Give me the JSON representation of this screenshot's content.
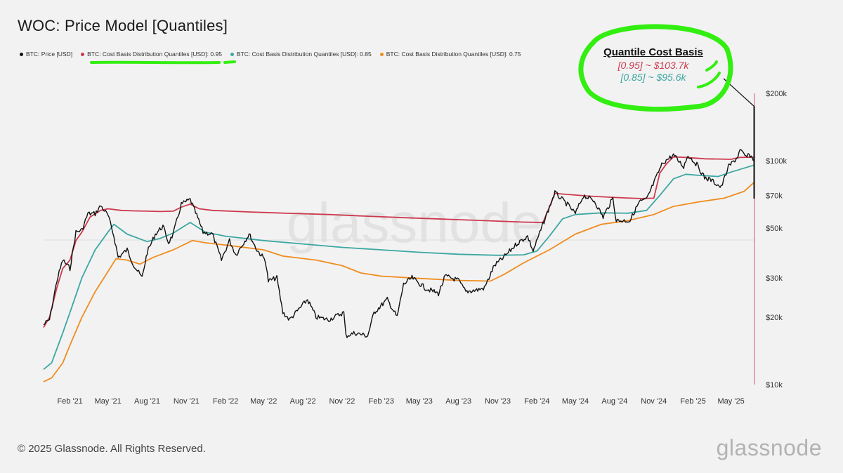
{
  "chart_data": {
    "type": "line",
    "title": "WOC: Price Model [Quantiles]",
    "y_scale": "log",
    "ylim": [
      10000,
      200000
    ],
    "x_range": [
      "2020-12-01",
      "2025-06-25"
    ],
    "x_ticks": [
      "Feb '21",
      "May '21",
      "Aug '21",
      "Nov '21",
      "Feb '22",
      "May '22",
      "Aug '22",
      "Nov '22",
      "Feb '23",
      "May '23",
      "Aug '23",
      "Nov '23",
      "Feb '24",
      "May '24",
      "Aug '24",
      "Nov '24",
      "Feb '25",
      "May '25"
    ],
    "x_tick_dates": [
      "2021-02-01",
      "2021-05-01",
      "2021-08-01",
      "2021-11-01",
      "2022-02-01",
      "2022-05-01",
      "2022-08-01",
      "2022-11-01",
      "2023-02-01",
      "2023-05-01",
      "2023-08-01",
      "2023-11-01",
      "2024-02-01",
      "2024-05-01",
      "2024-08-01",
      "2024-11-01",
      "2025-02-01",
      "2025-05-01"
    ],
    "y_ticks": [
      {
        "value": 10000,
        "label": "$10k"
      },
      {
        "value": 20000,
        "label": "$20k"
      },
      {
        "value": 30000,
        "label": "$30k"
      },
      {
        "value": 50000,
        "label": "$50k"
      },
      {
        "value": 70000,
        "label": "$70k"
      },
      {
        "value": 100000,
        "label": "$100k"
      },
      {
        "value": 200000,
        "label": "$200k"
      }
    ],
    "series": [
      {
        "name": "BTC: Price [USD]",
        "color": "#111111",
        "points": [
          [
            "2020-12-01",
            18500
          ],
          [
            "2020-12-15",
            19500
          ],
          [
            "2021-01-01",
            29000
          ],
          [
            "2021-01-15",
            36000
          ],
          [
            "2021-02-01",
            33000
          ],
          [
            "2021-02-15",
            48000
          ],
          [
            "2021-03-01",
            49000
          ],
          [
            "2021-03-15",
            58000
          ],
          [
            "2021-04-01",
            58000
          ],
          [
            "2021-04-14",
            63000
          ],
          [
            "2021-05-01",
            57000
          ],
          [
            "2021-05-15",
            46000
          ],
          [
            "2021-05-25",
            37000
          ],
          [
            "2021-06-15",
            40000
          ],
          [
            "2021-07-01",
            34000
          ],
          [
            "2021-07-20",
            30000
          ],
          [
            "2021-08-01",
            39000
          ],
          [
            "2021-08-20",
            47000
          ],
          [
            "2021-09-07",
            51000
          ],
          [
            "2021-09-20",
            43000
          ],
          [
            "2021-10-01",
            47000
          ],
          [
            "2021-10-20",
            64000
          ],
          [
            "2021-11-10",
            67000
          ],
          [
            "2021-11-25",
            57000
          ],
          [
            "2021-12-10",
            48000
          ],
          [
            "2022-01-01",
            47000
          ],
          [
            "2022-01-22",
            36000
          ],
          [
            "2022-02-10",
            44000
          ],
          [
            "2022-02-25",
            38000
          ],
          [
            "2022-03-28",
            47000
          ],
          [
            "2022-04-15",
            40000
          ],
          [
            "2022-05-05",
            36000
          ],
          [
            "2022-05-12",
            29000
          ],
          [
            "2022-06-01",
            30000
          ],
          [
            "2022-06-15",
            21000
          ],
          [
            "2022-07-01",
            19500
          ],
          [
            "2022-08-12",
            24000
          ],
          [
            "2022-09-01",
            20000
          ],
          [
            "2022-10-01",
            19500
          ],
          [
            "2022-11-05",
            21000
          ],
          [
            "2022-11-10",
            16500
          ],
          [
            "2022-12-01",
            17000
          ],
          [
            "2022-12-31",
            16500
          ],
          [
            "2023-01-15",
            21000
          ],
          [
            "2023-02-15",
            24000
          ],
          [
            "2023-03-10",
            20000
          ],
          [
            "2023-03-25",
            28000
          ],
          [
            "2023-04-14",
            30000
          ],
          [
            "2023-05-15",
            27000
          ],
          [
            "2023-06-15",
            25500
          ],
          [
            "2023-07-01",
            30500
          ],
          [
            "2023-08-01",
            29200
          ],
          [
            "2023-08-18",
            26000
          ],
          [
            "2023-09-15",
            26500
          ],
          [
            "2023-10-01",
            27000
          ],
          [
            "2023-10-24",
            34000
          ],
          [
            "2023-11-15",
            37000
          ],
          [
            "2023-12-15",
            42500
          ],
          [
            "2024-01-10",
            46000
          ],
          [
            "2024-01-23",
            39500
          ],
          [
            "2024-02-15",
            52000
          ],
          [
            "2024-03-14",
            72000
          ],
          [
            "2024-04-15",
            63000
          ],
          [
            "2024-05-01",
            58000
          ],
          [
            "2024-05-20",
            70000
          ],
          [
            "2024-06-15",
            66000
          ],
          [
            "2024-07-05",
            56000
          ],
          [
            "2024-07-28",
            68000
          ],
          [
            "2024-08-05",
            54000
          ],
          [
            "2024-09-06",
            54000
          ],
          [
            "2024-09-28",
            65500
          ],
          [
            "2024-10-15",
            67000
          ],
          [
            "2024-11-12",
            89000
          ],
          [
            "2024-11-22",
            98000
          ],
          [
            "2024-12-17",
            106000
          ],
          [
            "2025-01-10",
            94000
          ],
          [
            "2025-01-20",
            106000
          ],
          [
            "2025-02-10",
            96000
          ],
          [
            "2025-02-28",
            84000
          ],
          [
            "2025-03-15",
            82000
          ],
          [
            "2025-04-08",
            76000
          ],
          [
            "2025-04-25",
            94000
          ],
          [
            "2025-05-15",
            103000
          ],
          [
            "2025-05-22",
            111000
          ],
          [
            "2025-06-05",
            104000
          ],
          [
            "2025-06-15",
            106000
          ],
          [
            "2025-06-22",
            101000
          ],
          [
            "2025-06-24",
            105000
          ]
        ]
      },
      {
        "name": "BTC: Cost Basis Distribution Quantiles [USD]: 0.95",
        "color": "#cc3a4e",
        "points": [
          [
            "2020-12-01",
            18000
          ],
          [
            "2020-12-15",
            20000
          ],
          [
            "2021-01-01",
            27000
          ],
          [
            "2021-01-15",
            33000
          ],
          [
            "2021-02-01",
            36000
          ],
          [
            "2021-02-15",
            44000
          ],
          [
            "2021-03-01",
            48000
          ],
          [
            "2021-03-20",
            56000
          ],
          [
            "2021-04-14",
            60000
          ],
          [
            "2021-05-01",
            61000
          ],
          [
            "2021-06-01",
            60000
          ],
          [
            "2021-07-01",
            59700
          ],
          [
            "2021-08-01",
            59500
          ],
          [
            "2021-09-01",
            59300
          ],
          [
            "2021-10-01",
            59500
          ],
          [
            "2021-10-20",
            62000
          ],
          [
            "2021-11-10",
            64000
          ],
          [
            "2021-12-01",
            61000
          ],
          [
            "2022-01-01",
            60000
          ],
          [
            "2022-04-01",
            59000
          ],
          [
            "2022-07-01",
            58200
          ],
          [
            "2022-10-01",
            57500
          ],
          [
            "2023-01-01",
            56500
          ],
          [
            "2023-04-01",
            55600
          ],
          [
            "2023-07-01",
            54800
          ],
          [
            "2023-10-01",
            54000
          ],
          [
            "2024-01-01",
            53200
          ],
          [
            "2024-02-15",
            53000
          ],
          [
            "2024-03-01",
            62000
          ],
          [
            "2024-03-14",
            71500
          ],
          [
            "2024-04-01",
            71000
          ],
          [
            "2024-06-01",
            69500
          ],
          [
            "2024-08-01",
            68500
          ],
          [
            "2024-10-01",
            67800
          ],
          [
            "2024-11-01",
            68000
          ],
          [
            "2024-11-15",
            88000
          ],
          [
            "2024-12-01",
            97000
          ],
          [
            "2024-12-17",
            104000
          ],
          [
            "2025-01-15",
            103500
          ],
          [
            "2025-03-01",
            102000
          ],
          [
            "2025-05-01",
            101500
          ],
          [
            "2025-05-22",
            103500
          ],
          [
            "2025-06-24",
            103700
          ]
        ]
      },
      {
        "name": "BTC: Cost Basis Distribution Quantiles [USD]: 0.85",
        "color": "#3ca7a2",
        "points": [
          [
            "2020-12-01",
            11700
          ],
          [
            "2020-12-20",
            12500
          ],
          [
            "2021-01-15",
            17000
          ],
          [
            "2021-02-01",
            21000
          ],
          [
            "2021-03-01",
            30000
          ],
          [
            "2021-04-01",
            40000
          ],
          [
            "2021-05-01",
            48000
          ],
          [
            "2021-05-15",
            52000
          ],
          [
            "2021-06-15",
            47000
          ],
          [
            "2021-08-01",
            43500
          ],
          [
            "2021-09-01",
            45000
          ],
          [
            "2021-10-01",
            47500
          ],
          [
            "2021-11-10",
            53000
          ],
          [
            "2021-12-15",
            48000
          ],
          [
            "2022-02-01",
            46000
          ],
          [
            "2022-05-01",
            44000
          ],
          [
            "2022-08-01",
            42500
          ],
          [
            "2022-11-01",
            41000
          ],
          [
            "2023-02-01",
            40000
          ],
          [
            "2023-05-01",
            39000
          ],
          [
            "2023-08-01",
            38200
          ],
          [
            "2023-11-01",
            37800
          ],
          [
            "2024-01-01",
            38000
          ],
          [
            "2024-02-01",
            39500
          ],
          [
            "2024-03-01",
            46000
          ],
          [
            "2024-04-01",
            55000
          ],
          [
            "2024-05-01",
            57500
          ],
          [
            "2024-07-01",
            58500
          ],
          [
            "2024-09-01",
            58300
          ],
          [
            "2024-10-15",
            60000
          ],
          [
            "2024-11-15",
            70000
          ],
          [
            "2024-12-17",
            83000
          ],
          [
            "2025-01-15",
            87000
          ],
          [
            "2025-02-15",
            86000
          ],
          [
            "2025-04-01",
            85000
          ],
          [
            "2025-05-01",
            89000
          ],
          [
            "2025-06-24",
            95600
          ]
        ]
      },
      {
        "name": "BTC: Cost Basis Distribution Quantiles [USD]: 0.75",
        "color": "#f08c1e",
        "points": [
          [
            "2020-12-01",
            10300
          ],
          [
            "2020-12-20",
            10700
          ],
          [
            "2021-01-15",
            12500
          ],
          [
            "2021-02-01",
            15000
          ],
          [
            "2021-03-01",
            20000
          ],
          [
            "2021-04-01",
            26000
          ],
          [
            "2021-05-01",
            32000
          ],
          [
            "2021-05-20",
            36500
          ],
          [
            "2021-06-15",
            36000
          ],
          [
            "2021-07-15",
            34500
          ],
          [
            "2021-08-15",
            37000
          ],
          [
            "2021-10-01",
            40000
          ],
          [
            "2021-11-15",
            44000
          ],
          [
            "2021-12-15",
            43000
          ],
          [
            "2022-02-01",
            42000
          ],
          [
            "2022-05-01",
            40000
          ],
          [
            "2022-06-15",
            37500
          ],
          [
            "2022-09-01",
            36000
          ],
          [
            "2022-11-01",
            34000
          ],
          [
            "2022-12-15",
            31500
          ],
          [
            "2023-02-01",
            30500
          ],
          [
            "2023-05-01",
            29800
          ],
          [
            "2023-08-01",
            29200
          ],
          [
            "2023-10-15",
            29000
          ],
          [
            "2023-11-15",
            31000
          ],
          [
            "2024-01-01",
            35000
          ],
          [
            "2024-03-01",
            40000
          ],
          [
            "2024-05-01",
            47000
          ],
          [
            "2024-07-01",
            52000
          ],
          [
            "2024-09-01",
            54000
          ],
          [
            "2024-11-01",
            57500
          ],
          [
            "2024-12-17",
            62500
          ],
          [
            "2025-02-15",
            65500
          ],
          [
            "2025-04-15",
            68000
          ],
          [
            "2025-06-01",
            73000
          ],
          [
            "2025-06-24",
            80000
          ]
        ]
      }
    ],
    "annotation": {
      "title": "Quantile Cost Basis",
      "q95": "[0.95] ~ $103.7k",
      "q85": "[0.85] ~ $95.6k"
    },
    "legend_position": "top-left",
    "grid": false
  },
  "legend": [
    {
      "label": "BTC: Price [USD]",
      "color": "#111111"
    },
    {
      "label": "BTC: Cost Basis Distribution Quantiles [USD]: 0.95",
      "color": "#cc3a4e"
    },
    {
      "label": "BTC: Cost Basis Distribution Quantiles [USD]: 0.85",
      "color": "#3ca7a2"
    },
    {
      "label": "BTC: Cost Basis Distribution Quantiles [USD]: 0.75",
      "color": "#f08c1e"
    }
  ],
  "watermark": "glassnode",
  "footer": "© 2025 Glassnode. All Rights Reserved.",
  "brand": "glassnode",
  "highlight_color": "#33ee11"
}
